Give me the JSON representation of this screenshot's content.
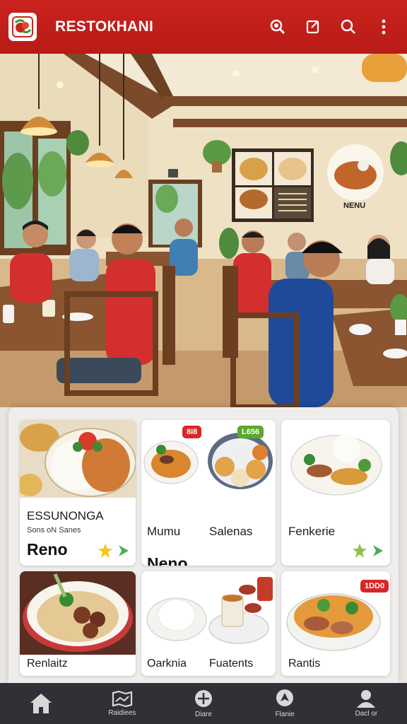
{
  "app": {
    "title": "RESTOКНANI"
  },
  "hero": {
    "menu_sign": "NENU"
  },
  "cards": [
    {
      "title": "ESSUNONGA",
      "subtitle": "Sons oN Sanes",
      "price": "Reno"
    },
    {
      "title": "Mumu",
      "price": "Neno",
      "badge": "8i8"
    },
    {
      "title": "Salenas",
      "badge": "L656"
    },
    {
      "title": "Fenkerie"
    },
    {
      "title": "Renlaitz"
    },
    {
      "title": "Oarknia"
    },
    {
      "title": "Fuatents"
    },
    {
      "title": "Rantis",
      "badge": "1DD0"
    }
  ],
  "nav": [
    {
      "label": "",
      "icon": "home-icon"
    },
    {
      "label": "Raidiees",
      "icon": "map-icon"
    },
    {
      "label": "Diare",
      "icon": "compass-icon"
    },
    {
      "label": "Flanie",
      "icon": "location-icon"
    },
    {
      "label": "Dacl or",
      "icon": "profile-icon"
    }
  ],
  "colors": {
    "brand_red": "#c9231e",
    "nav_bg": "#2f3136",
    "star": "#f5c518",
    "arrow": "#4caf50"
  }
}
